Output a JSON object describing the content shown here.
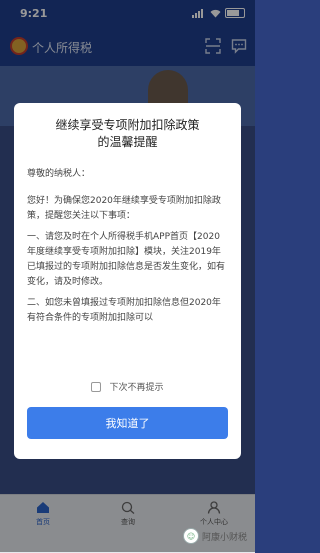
{
  "status": {
    "time": "9:21",
    "location_icon": "location-arrow-icon"
  },
  "app": {
    "title": "个人所得税"
  },
  "dialog": {
    "title_line1": "继续享受专项附加扣除政策",
    "title_line2": "的温馨提醒",
    "greeting": "尊敬的纳税人：",
    "para1": "您好！为确保您2020年继续享受专项附加扣除政策，提醒您关注以下事项：",
    "para2_pre": "一、请您及时在个人所得税手机APP首页",
    "para2_highlight": "【2020年度继续享受专项附加扣除】",
    "para2_post": "模块，关注2019年已填报过的专项附加扣除信息是否发生变化，如有变化，请及时修改。",
    "para3": "二、如您未曾填报过专项附加扣除信息但2020年有符合条件的专项附加扣除可以",
    "dont_show_label": "下次不再提示",
    "ok_label": "我知道了"
  },
  "tabs": {
    "home": "首页",
    "query": "查询",
    "me": "个人中心"
  },
  "watermark": "阿康小财税",
  "colors": {
    "header": "#1f3f8c",
    "accent": "#3c7dea",
    "tab_active": "#2b63c8"
  }
}
